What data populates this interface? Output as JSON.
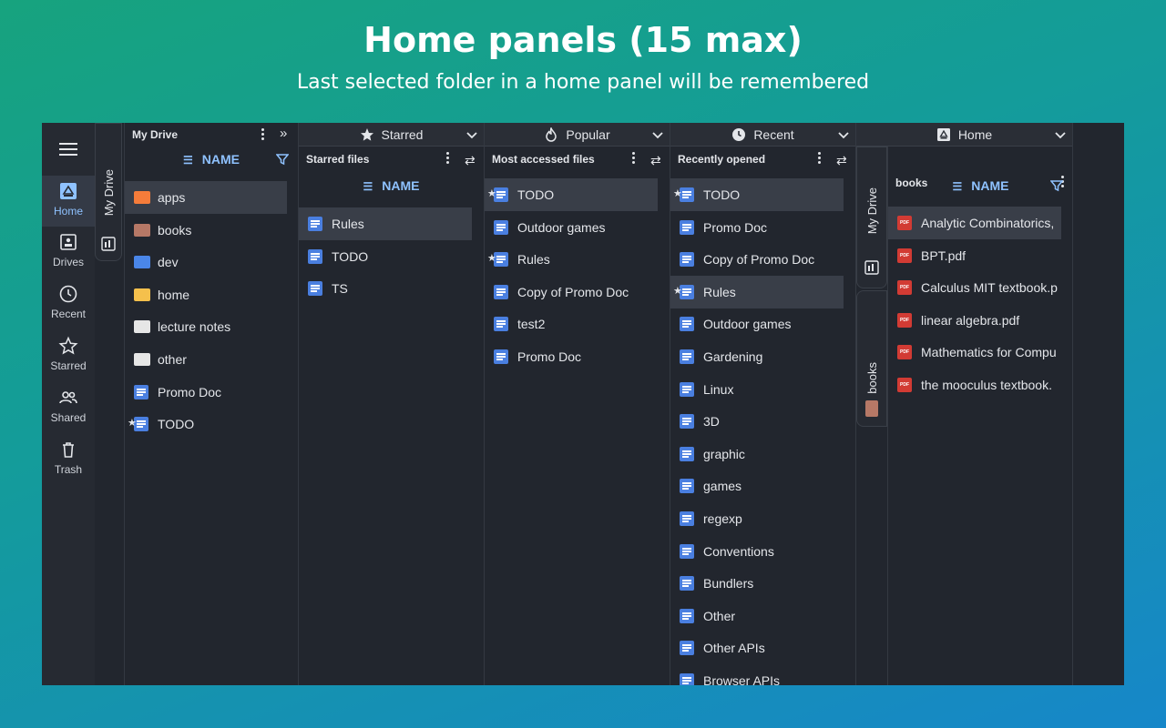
{
  "hero": {
    "title": "Home panels (15 max)",
    "subtitle": "Last selected folder in a home panel will be remembered"
  },
  "rail": {
    "items": [
      {
        "label": "Home",
        "icon": "drive-home-icon",
        "active": true
      },
      {
        "label": "Drives",
        "icon": "drives-icon"
      },
      {
        "label": "Recent",
        "icon": "clock-icon"
      },
      {
        "label": "Starred",
        "icon": "star-icon"
      },
      {
        "label": "Shared",
        "icon": "people-icon"
      },
      {
        "label": "Trash",
        "icon": "trash-icon"
      }
    ]
  },
  "panel1": {
    "title": "My Drive",
    "column": "NAME",
    "side_tab": "My Drive",
    "items": [
      {
        "name": "apps",
        "type": "folder",
        "color": "#f57c3a",
        "selected": true
      },
      {
        "name": "books",
        "type": "folder",
        "color": "#b67866"
      },
      {
        "name": "dev",
        "type": "folder",
        "color": "#4a86e8"
      },
      {
        "name": "home",
        "type": "folder",
        "color": "#f5c04c"
      },
      {
        "name": "lecture notes",
        "type": "folder",
        "color": "#e6e6e6"
      },
      {
        "name": "other",
        "type": "folder",
        "color": "#e6e6e6"
      },
      {
        "name": "Promo Doc",
        "type": "doc"
      },
      {
        "name": "TODO",
        "type": "doc",
        "starred": true
      }
    ]
  },
  "panel2": {
    "title": "Starred",
    "subtitle": "Starred files",
    "column": "NAME",
    "items": [
      {
        "name": "Rules",
        "type": "doc",
        "selected": true
      },
      {
        "name": "TODO",
        "type": "doc"
      },
      {
        "name": "TS",
        "type": "doc"
      }
    ]
  },
  "panel3": {
    "title": "Popular",
    "subtitle": "Most accessed files",
    "items": [
      {
        "name": "TODO",
        "type": "doc",
        "starred": true,
        "selected": true
      },
      {
        "name": "Outdoor games",
        "type": "doc"
      },
      {
        "name": "Rules",
        "type": "doc",
        "starred": true
      },
      {
        "name": "Copy of Promo Doc",
        "type": "doc"
      },
      {
        "name": "test2",
        "type": "doc"
      },
      {
        "name": "Promo Doc",
        "type": "doc"
      }
    ]
  },
  "panel4": {
    "title": "Recent",
    "subtitle": "Recently opened",
    "items": [
      {
        "name": "TODO",
        "type": "doc",
        "starred": true,
        "selected": true
      },
      {
        "name": "Promo Doc",
        "type": "doc"
      },
      {
        "name": "Copy of Promo Doc",
        "type": "doc"
      },
      {
        "name": "Rules",
        "type": "doc",
        "starred": true,
        "selected": true
      },
      {
        "name": "Outdoor games",
        "type": "doc"
      },
      {
        "name": "Gardening",
        "type": "doc"
      },
      {
        "name": "Linux",
        "type": "doc"
      },
      {
        "name": "3D",
        "type": "doc"
      },
      {
        "name": "graphic",
        "type": "doc"
      },
      {
        "name": "games",
        "type": "doc"
      },
      {
        "name": "regexp",
        "type": "doc"
      },
      {
        "name": "Conventions",
        "type": "doc"
      },
      {
        "name": "Bundlers",
        "type": "doc"
      },
      {
        "name": "Other",
        "type": "doc"
      },
      {
        "name": "Other APIs",
        "type": "doc"
      },
      {
        "name": "Browser APIs",
        "type": "doc"
      }
    ]
  },
  "panel5": {
    "title": "Home",
    "subtitle": "books",
    "column": "NAME",
    "side_tab_top": "My Drive",
    "side_tab_bottom": "books",
    "items": [
      {
        "name": "Analytic Combinatorics,",
        "type": "pdf",
        "selected": true
      },
      {
        "name": "BPT.pdf",
        "type": "pdf"
      },
      {
        "name": "Calculus MIT textbook.p",
        "type": "pdf"
      },
      {
        "name": "linear algebra.pdf",
        "type": "pdf"
      },
      {
        "name": "Mathematics for Compu",
        "type": "pdf"
      },
      {
        "name": "the mooculus textbook.",
        "type": "pdf"
      }
    ]
  },
  "colors": {
    "accent": "#8fc2ff",
    "doc": "#4a7fe0",
    "pdf": "#d23b34"
  }
}
